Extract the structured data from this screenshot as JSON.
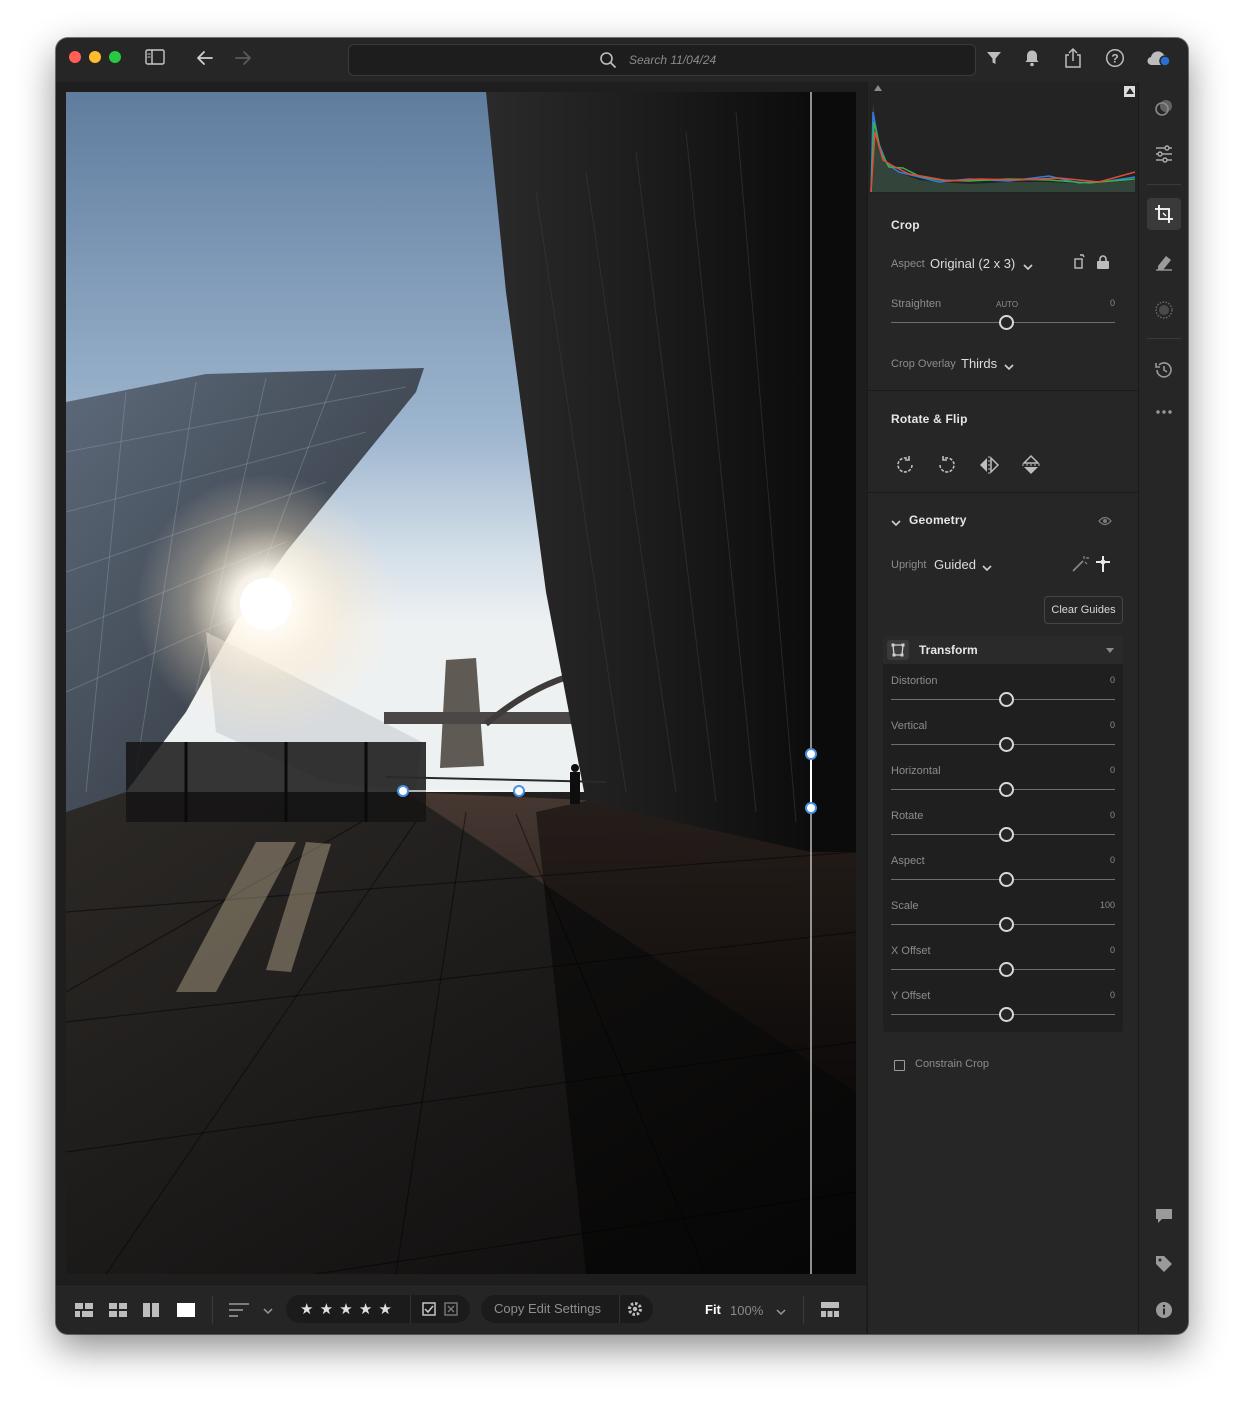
{
  "search": {
    "placeholder": "Search 11/04/24"
  },
  "crop": {
    "title": "Crop",
    "aspect_label": "Aspect",
    "aspect_value": "Original (2 x 3)",
    "straighten_label": "Straighten",
    "straighten_auto": "AUTO",
    "straighten_value": "0",
    "overlay_label": "Crop Overlay",
    "overlay_value": "Thirds"
  },
  "rotate_flip": {
    "title": "Rotate & Flip"
  },
  "geometry": {
    "title": "Geometry",
    "upright_label": "Upright",
    "upright_value": "Guided",
    "clear_guides": "Clear Guides",
    "transform_title": "Transform",
    "sliders": [
      {
        "label": "Distortion",
        "value": "0"
      },
      {
        "label": "Vertical",
        "value": "0"
      },
      {
        "label": "Horizontal",
        "value": "0"
      },
      {
        "label": "Rotate",
        "value": "0"
      },
      {
        "label": "Aspect",
        "value": "0"
      },
      {
        "label": "Scale",
        "value": "100"
      },
      {
        "label": "X Offset",
        "value": "0"
      },
      {
        "label": "Y Offset",
        "value": "0"
      }
    ],
    "constrain_crop": "Constrain Crop"
  },
  "bottombar": {
    "rating": "★ ★ ★ ★ ★",
    "copy_edit": "Copy Edit Settings",
    "fit": "Fit",
    "zoom": "100%"
  },
  "colors": {
    "accent": "#4a90e2",
    "panel_bg": "#262626",
    "window_bg": "#1e1e1e"
  },
  "icons": [
    "sidebar-icon",
    "back-icon",
    "forward-icon",
    "search-icon",
    "filter-icon",
    "bell-icon",
    "share-icon",
    "help-icon",
    "cloud-icon",
    "presets-icon",
    "edit-sliders-icon",
    "crop-icon",
    "healing-icon",
    "masking-icon",
    "history-icon",
    "more-icon",
    "comment-icon",
    "tag-icon",
    "info-icon"
  ]
}
